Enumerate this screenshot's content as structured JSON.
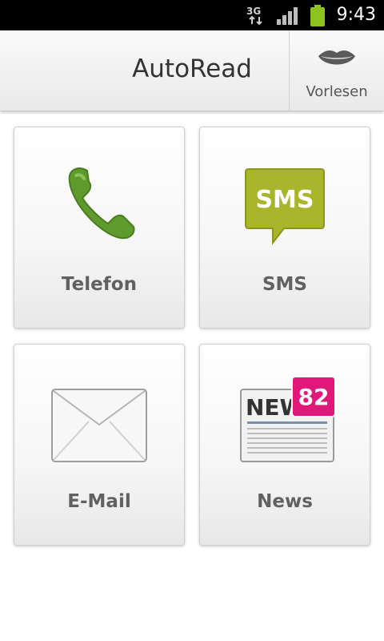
{
  "status_bar": {
    "network": "3G",
    "time": "9:43",
    "signal_icon": "signal-bars-icon",
    "battery_icon": "battery-icon",
    "battery_color": "#8ec21f"
  },
  "action_bar": {
    "title": "AutoRead",
    "read_button": {
      "label": "Vorlesen",
      "icon": "lips-icon"
    }
  },
  "tiles": [
    {
      "label": "Telefon",
      "icon": "phone-handset-icon",
      "color": "#5e9a2c"
    },
    {
      "label": "SMS",
      "icon": "sms-bubble-icon",
      "icon_text": "SMS",
      "color": "#a9b52a"
    },
    {
      "label": "E-Mail",
      "icon": "envelope-icon"
    },
    {
      "label": "News",
      "icon": "newspaper-icon",
      "icon_text": "NEWS",
      "badge": "82",
      "badge_color": "#e0187a"
    }
  ]
}
